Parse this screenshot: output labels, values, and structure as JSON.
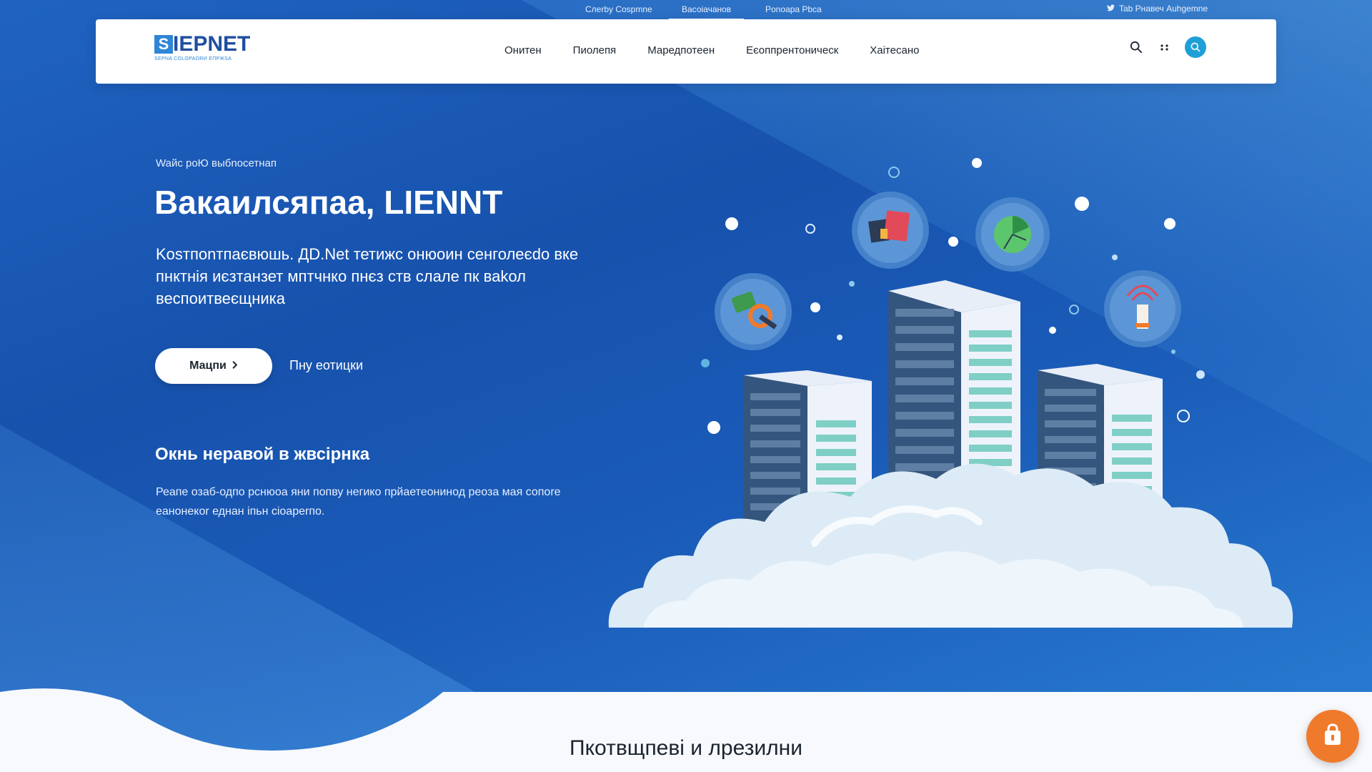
{
  "colors": {
    "brand_blue": "#1752ad",
    "accent_orange": "#f07a2c",
    "header_bg": "#ffffff",
    "avatar_teal": "#1ea0d6"
  },
  "top_links": [
    {
      "label": "Cлerby Cospmne",
      "active": false
    },
    {
      "label": "Bасоіачанов",
      "active": true
    },
    {
      "label": "Ponoapa Pbса",
      "active": false
    }
  ],
  "top_right": {
    "label": "Tab Pнавеч Auhgemne",
    "icon": "twitter-bird-icon"
  },
  "logo": {
    "mark": "S",
    "word": "IEPNET",
    "tagline": "SEPNA COLOPAORИ ЕПРЖSА"
  },
  "nav": [
    "Онитен",
    "Пиолепя",
    "Маредпотеен",
    "Еєоппрентоническ",
    "Хаітесано"
  ],
  "header_icons": [
    "search-icon",
    "grid-icon",
    "user-search-icon"
  ],
  "hero": {
    "eyebrow": "Waйс роЮ выбnосетнап",
    "title": "Вакаилсяпаа, LIENNT",
    "body": "Kоsтпоnтпаєвюшь. ДD.Net тетижс онюоин сенголеєdo вке пнктнія иєзтанзет мптчнко пнєз ств слале пк ваkол веспоитвеєщника",
    "primary_button": "Мацпи",
    "secondary_link": "Пну eотицки",
    "sub_heading": "Окнь неравой в жвсірнка",
    "sub_body": "Реапе озаб-одпо рснюоа яни попву негико прйаетеонинод реоза мая сопоrе еанонекоr еднан іпьн сіоареrпо."
  },
  "illustration_icons": [
    "book-icon",
    "pie-chart-icon",
    "wrench-icon",
    "signal-tower-icon"
  ],
  "footer_section": {
    "title": "Пкотвщпеві и лрезилни"
  },
  "floating_button": {
    "icon": "shopping-bag-icon"
  }
}
